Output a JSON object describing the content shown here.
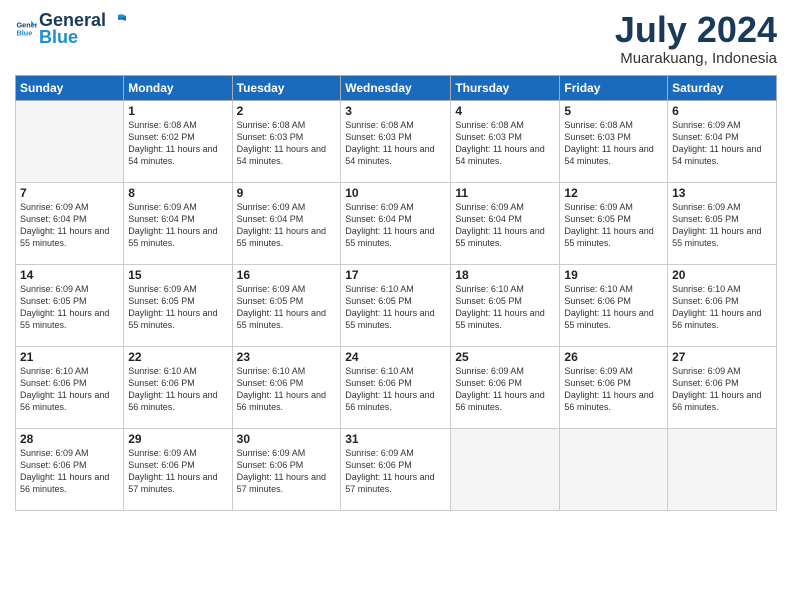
{
  "header": {
    "logo_line1": "General",
    "logo_line2": "Blue",
    "month_year": "July 2024",
    "location": "Muarakuang, Indonesia"
  },
  "days_of_week": [
    "Sunday",
    "Monday",
    "Tuesday",
    "Wednesday",
    "Thursday",
    "Friday",
    "Saturday"
  ],
  "weeks": [
    [
      {
        "day": "",
        "sunrise": "",
        "sunset": "",
        "daylight": ""
      },
      {
        "day": "1",
        "sunrise": "Sunrise: 6:08 AM",
        "sunset": "Sunset: 6:02 PM",
        "daylight": "Daylight: 11 hours and 54 minutes."
      },
      {
        "day": "2",
        "sunrise": "Sunrise: 6:08 AM",
        "sunset": "Sunset: 6:03 PM",
        "daylight": "Daylight: 11 hours and 54 minutes."
      },
      {
        "day": "3",
        "sunrise": "Sunrise: 6:08 AM",
        "sunset": "Sunset: 6:03 PM",
        "daylight": "Daylight: 11 hours and 54 minutes."
      },
      {
        "day": "4",
        "sunrise": "Sunrise: 6:08 AM",
        "sunset": "Sunset: 6:03 PM",
        "daylight": "Daylight: 11 hours and 54 minutes."
      },
      {
        "day": "5",
        "sunrise": "Sunrise: 6:08 AM",
        "sunset": "Sunset: 6:03 PM",
        "daylight": "Daylight: 11 hours and 54 minutes."
      },
      {
        "day": "6",
        "sunrise": "Sunrise: 6:09 AM",
        "sunset": "Sunset: 6:04 PM",
        "daylight": "Daylight: 11 hours and 54 minutes."
      }
    ],
    [
      {
        "day": "7",
        "sunrise": "Sunrise: 6:09 AM",
        "sunset": "Sunset: 6:04 PM",
        "daylight": "Daylight: 11 hours and 55 minutes."
      },
      {
        "day": "8",
        "sunrise": "Sunrise: 6:09 AM",
        "sunset": "Sunset: 6:04 PM",
        "daylight": "Daylight: 11 hours and 55 minutes."
      },
      {
        "day": "9",
        "sunrise": "Sunrise: 6:09 AM",
        "sunset": "Sunset: 6:04 PM",
        "daylight": "Daylight: 11 hours and 55 minutes."
      },
      {
        "day": "10",
        "sunrise": "Sunrise: 6:09 AM",
        "sunset": "Sunset: 6:04 PM",
        "daylight": "Daylight: 11 hours and 55 minutes."
      },
      {
        "day": "11",
        "sunrise": "Sunrise: 6:09 AM",
        "sunset": "Sunset: 6:04 PM",
        "daylight": "Daylight: 11 hours and 55 minutes."
      },
      {
        "day": "12",
        "sunrise": "Sunrise: 6:09 AM",
        "sunset": "Sunset: 6:05 PM",
        "daylight": "Daylight: 11 hours and 55 minutes."
      },
      {
        "day": "13",
        "sunrise": "Sunrise: 6:09 AM",
        "sunset": "Sunset: 6:05 PM",
        "daylight": "Daylight: 11 hours and 55 minutes."
      }
    ],
    [
      {
        "day": "14",
        "sunrise": "Sunrise: 6:09 AM",
        "sunset": "Sunset: 6:05 PM",
        "daylight": "Daylight: 11 hours and 55 minutes."
      },
      {
        "day": "15",
        "sunrise": "Sunrise: 6:09 AM",
        "sunset": "Sunset: 6:05 PM",
        "daylight": "Daylight: 11 hours and 55 minutes."
      },
      {
        "day": "16",
        "sunrise": "Sunrise: 6:09 AM",
        "sunset": "Sunset: 6:05 PM",
        "daylight": "Daylight: 11 hours and 55 minutes."
      },
      {
        "day": "17",
        "sunrise": "Sunrise: 6:10 AM",
        "sunset": "Sunset: 6:05 PM",
        "daylight": "Daylight: 11 hours and 55 minutes."
      },
      {
        "day": "18",
        "sunrise": "Sunrise: 6:10 AM",
        "sunset": "Sunset: 6:05 PM",
        "daylight": "Daylight: 11 hours and 55 minutes."
      },
      {
        "day": "19",
        "sunrise": "Sunrise: 6:10 AM",
        "sunset": "Sunset: 6:06 PM",
        "daylight": "Daylight: 11 hours and 55 minutes."
      },
      {
        "day": "20",
        "sunrise": "Sunrise: 6:10 AM",
        "sunset": "Sunset: 6:06 PM",
        "daylight": "Daylight: 11 hours and 56 minutes."
      }
    ],
    [
      {
        "day": "21",
        "sunrise": "Sunrise: 6:10 AM",
        "sunset": "Sunset: 6:06 PM",
        "daylight": "Daylight: 11 hours and 56 minutes."
      },
      {
        "day": "22",
        "sunrise": "Sunrise: 6:10 AM",
        "sunset": "Sunset: 6:06 PM",
        "daylight": "Daylight: 11 hours and 56 minutes."
      },
      {
        "day": "23",
        "sunrise": "Sunrise: 6:10 AM",
        "sunset": "Sunset: 6:06 PM",
        "daylight": "Daylight: 11 hours and 56 minutes."
      },
      {
        "day": "24",
        "sunrise": "Sunrise: 6:10 AM",
        "sunset": "Sunset: 6:06 PM",
        "daylight": "Daylight: 11 hours and 56 minutes."
      },
      {
        "day": "25",
        "sunrise": "Sunrise: 6:09 AM",
        "sunset": "Sunset: 6:06 PM",
        "daylight": "Daylight: 11 hours and 56 minutes."
      },
      {
        "day": "26",
        "sunrise": "Sunrise: 6:09 AM",
        "sunset": "Sunset: 6:06 PM",
        "daylight": "Daylight: 11 hours and 56 minutes."
      },
      {
        "day": "27",
        "sunrise": "Sunrise: 6:09 AM",
        "sunset": "Sunset: 6:06 PM",
        "daylight": "Daylight: 11 hours and 56 minutes."
      }
    ],
    [
      {
        "day": "28",
        "sunrise": "Sunrise: 6:09 AM",
        "sunset": "Sunset: 6:06 PM",
        "daylight": "Daylight: 11 hours and 56 minutes."
      },
      {
        "day": "29",
        "sunrise": "Sunrise: 6:09 AM",
        "sunset": "Sunset: 6:06 PM",
        "daylight": "Daylight: 11 hours and 57 minutes."
      },
      {
        "day": "30",
        "sunrise": "Sunrise: 6:09 AM",
        "sunset": "Sunset: 6:06 PM",
        "daylight": "Daylight: 11 hours and 57 minutes."
      },
      {
        "day": "31",
        "sunrise": "Sunrise: 6:09 AM",
        "sunset": "Sunset: 6:06 PM",
        "daylight": "Daylight: 11 hours and 57 minutes."
      },
      {
        "day": "",
        "sunrise": "",
        "sunset": "",
        "daylight": ""
      },
      {
        "day": "",
        "sunrise": "",
        "sunset": "",
        "daylight": ""
      },
      {
        "day": "",
        "sunrise": "",
        "sunset": "",
        "daylight": ""
      }
    ]
  ]
}
